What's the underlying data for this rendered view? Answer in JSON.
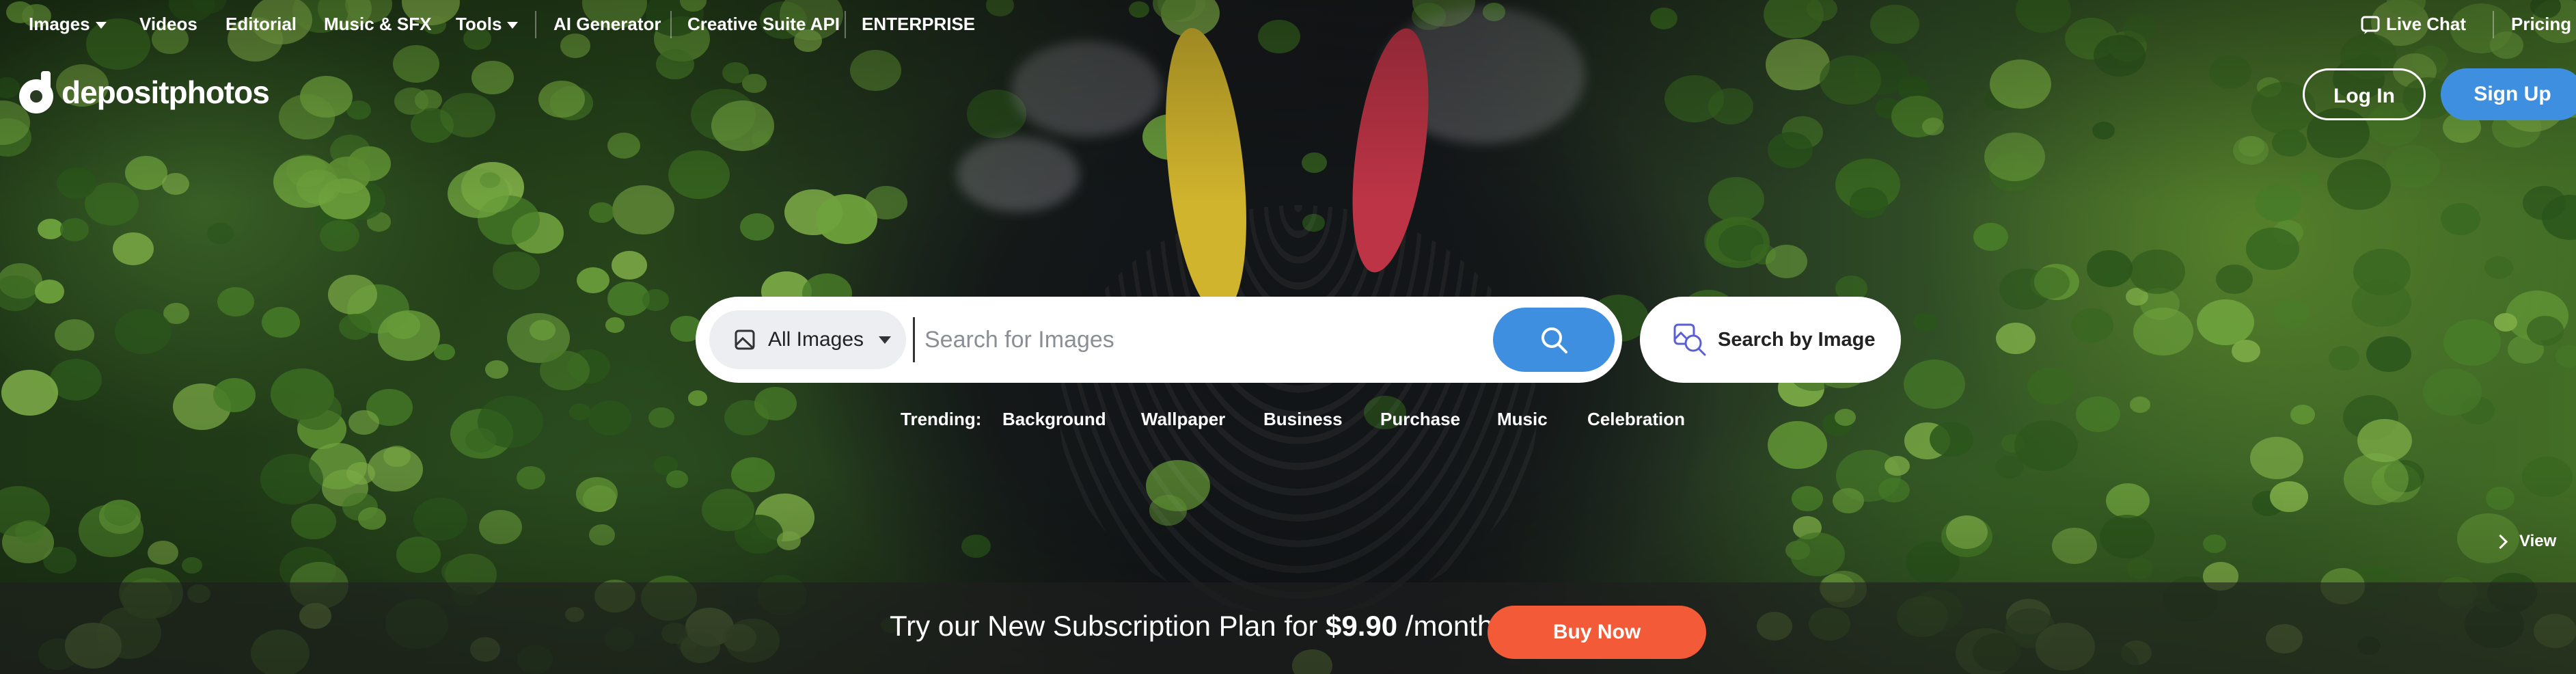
{
  "nav": {
    "items": [
      {
        "label": "Images",
        "has_caret": true
      },
      {
        "label": "Videos"
      },
      {
        "label": "Editorial"
      },
      {
        "label": "Music & SFX"
      },
      {
        "label": "Tools",
        "has_caret": true
      },
      {
        "label": "AI Generator"
      },
      {
        "label": "Creative Suite API"
      },
      {
        "label": "ENTERPRISE"
      }
    ],
    "live_chat": "Live Chat",
    "pricing": "Pricing"
  },
  "logo": {
    "text": "depositphotos"
  },
  "auth": {
    "login": "Log In",
    "signup": "Sign Up"
  },
  "search": {
    "filter_label": "All Images",
    "placeholder": "Search for Images",
    "search_by_image": "Search by Image"
  },
  "trending": {
    "label": "Trending:",
    "tags": [
      "Background",
      "Wallpaper",
      "Business",
      "Purchase",
      "Music",
      "Celebration"
    ]
  },
  "view_label": "View",
  "promo": {
    "text_before": "Try our New Subscription Plan for ",
    "price": "$9.90",
    "text_after": " /month",
    "button": "Buy Now"
  },
  "colors": {
    "accent_blue": "#3f8fe0",
    "buy_orange": "#f25a38"
  }
}
